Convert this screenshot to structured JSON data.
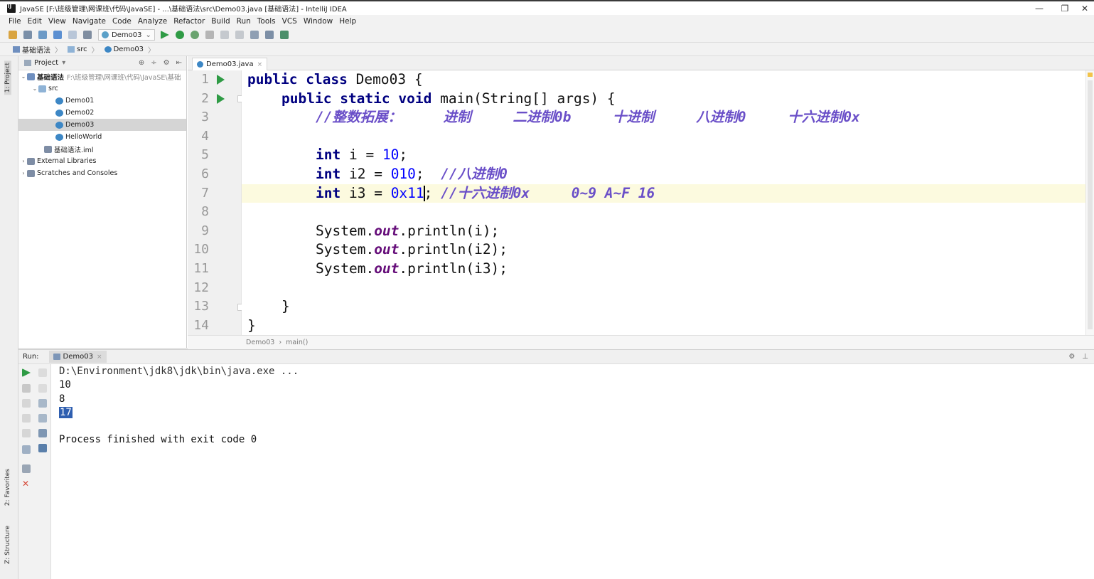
{
  "window": {
    "title": "JavaSE [F:\\班级管理\\网课班\\代码\\JavaSE] - ...\\基础语法\\src\\Demo03.java [基础语法] - IntelliJ IDEA",
    "min": "—",
    "restore": "❐",
    "close": "✕"
  },
  "menu": [
    "File",
    "Edit",
    "View",
    "Navigate",
    "Code",
    "Analyze",
    "Refactor",
    "Build",
    "Run",
    "Tools",
    "VCS",
    "Window",
    "Help"
  ],
  "toolbar": {
    "run_config": "Demo03",
    "dropdown": "⌄"
  },
  "navbar": {
    "crumbs": [
      "基础语法",
      "src",
      "Demo03"
    ]
  },
  "side_tabs": {
    "project": "1: Project",
    "favorites": "2: Favorites",
    "structure": "Z: Structure"
  },
  "project_panel": {
    "title": "Project",
    "dropdown": "▾",
    "tree": {
      "module": "基础语法",
      "module_path": "F:\\班级管理\\网课班\\代码\\JavaSE\\基础",
      "src": "src",
      "classes": [
        "Demo01",
        "Demo02",
        "Demo03",
        "HelloWorld"
      ],
      "iml": "基础语法.iml",
      "ext_libs": "External Libraries",
      "scratches": "Scratches and Consoles"
    }
  },
  "editor": {
    "tab": "Demo03.java",
    "line_numbers": [
      "1",
      "2",
      "3",
      "4",
      "5",
      "6",
      "7",
      "8",
      "9",
      "10",
      "11",
      "12",
      "13",
      "14"
    ],
    "l1": {
      "a": "public",
      "b": "class",
      "c": " Demo03 {"
    },
    "l2": {
      "a": "public",
      "b": "static",
      "c": "void",
      "d": " main(String[] args) {"
    },
    "l3": {
      "comment": "//整数拓展：     进制     二进制0b     十进制     八进制0     十六进制0x"
    },
    "l5": {
      "kw": "int",
      "a": " i = ",
      "num": "10",
      "b": ";"
    },
    "l6": {
      "kw": "int",
      "a": " i2 = ",
      "num": "010",
      "b": ";  ",
      "comment": "//八进制0"
    },
    "l7": {
      "kw": "int",
      "a": " i3 = ",
      "num": "0x11",
      "b": "; ",
      "comment": "//十六进制0x     0~9 A~F 16"
    },
    "l9": {
      "a": "System.",
      "field": "out",
      "b": ".println(i);"
    },
    "l10": {
      "a": "System.",
      "field": "out",
      "b": ".println(i2);"
    },
    "l11": {
      "a": "System.",
      "field": "out",
      "b": ".println(i3);"
    },
    "l13": {
      "a": "}"
    },
    "l14": {
      "a": "}"
    },
    "breadcrumb": [
      "Demo03",
      "main()"
    ]
  },
  "run_panel": {
    "label": "Run:",
    "tab": "Demo03",
    "console": {
      "command": "D:\\Environment\\jdk8\\jdk\\bin\\java.exe ...",
      "out1": "10",
      "out2": "8",
      "out3": "17",
      "finished": "Process finished with exit code 0"
    }
  },
  "colors": {
    "keyword": "#000080",
    "number": "#0000ff",
    "comment": "#6a4fc8",
    "field": "#660e7a",
    "run_green": "#2f9b45",
    "current_line": "#fcfadf",
    "selection": "#2f5fb0"
  }
}
